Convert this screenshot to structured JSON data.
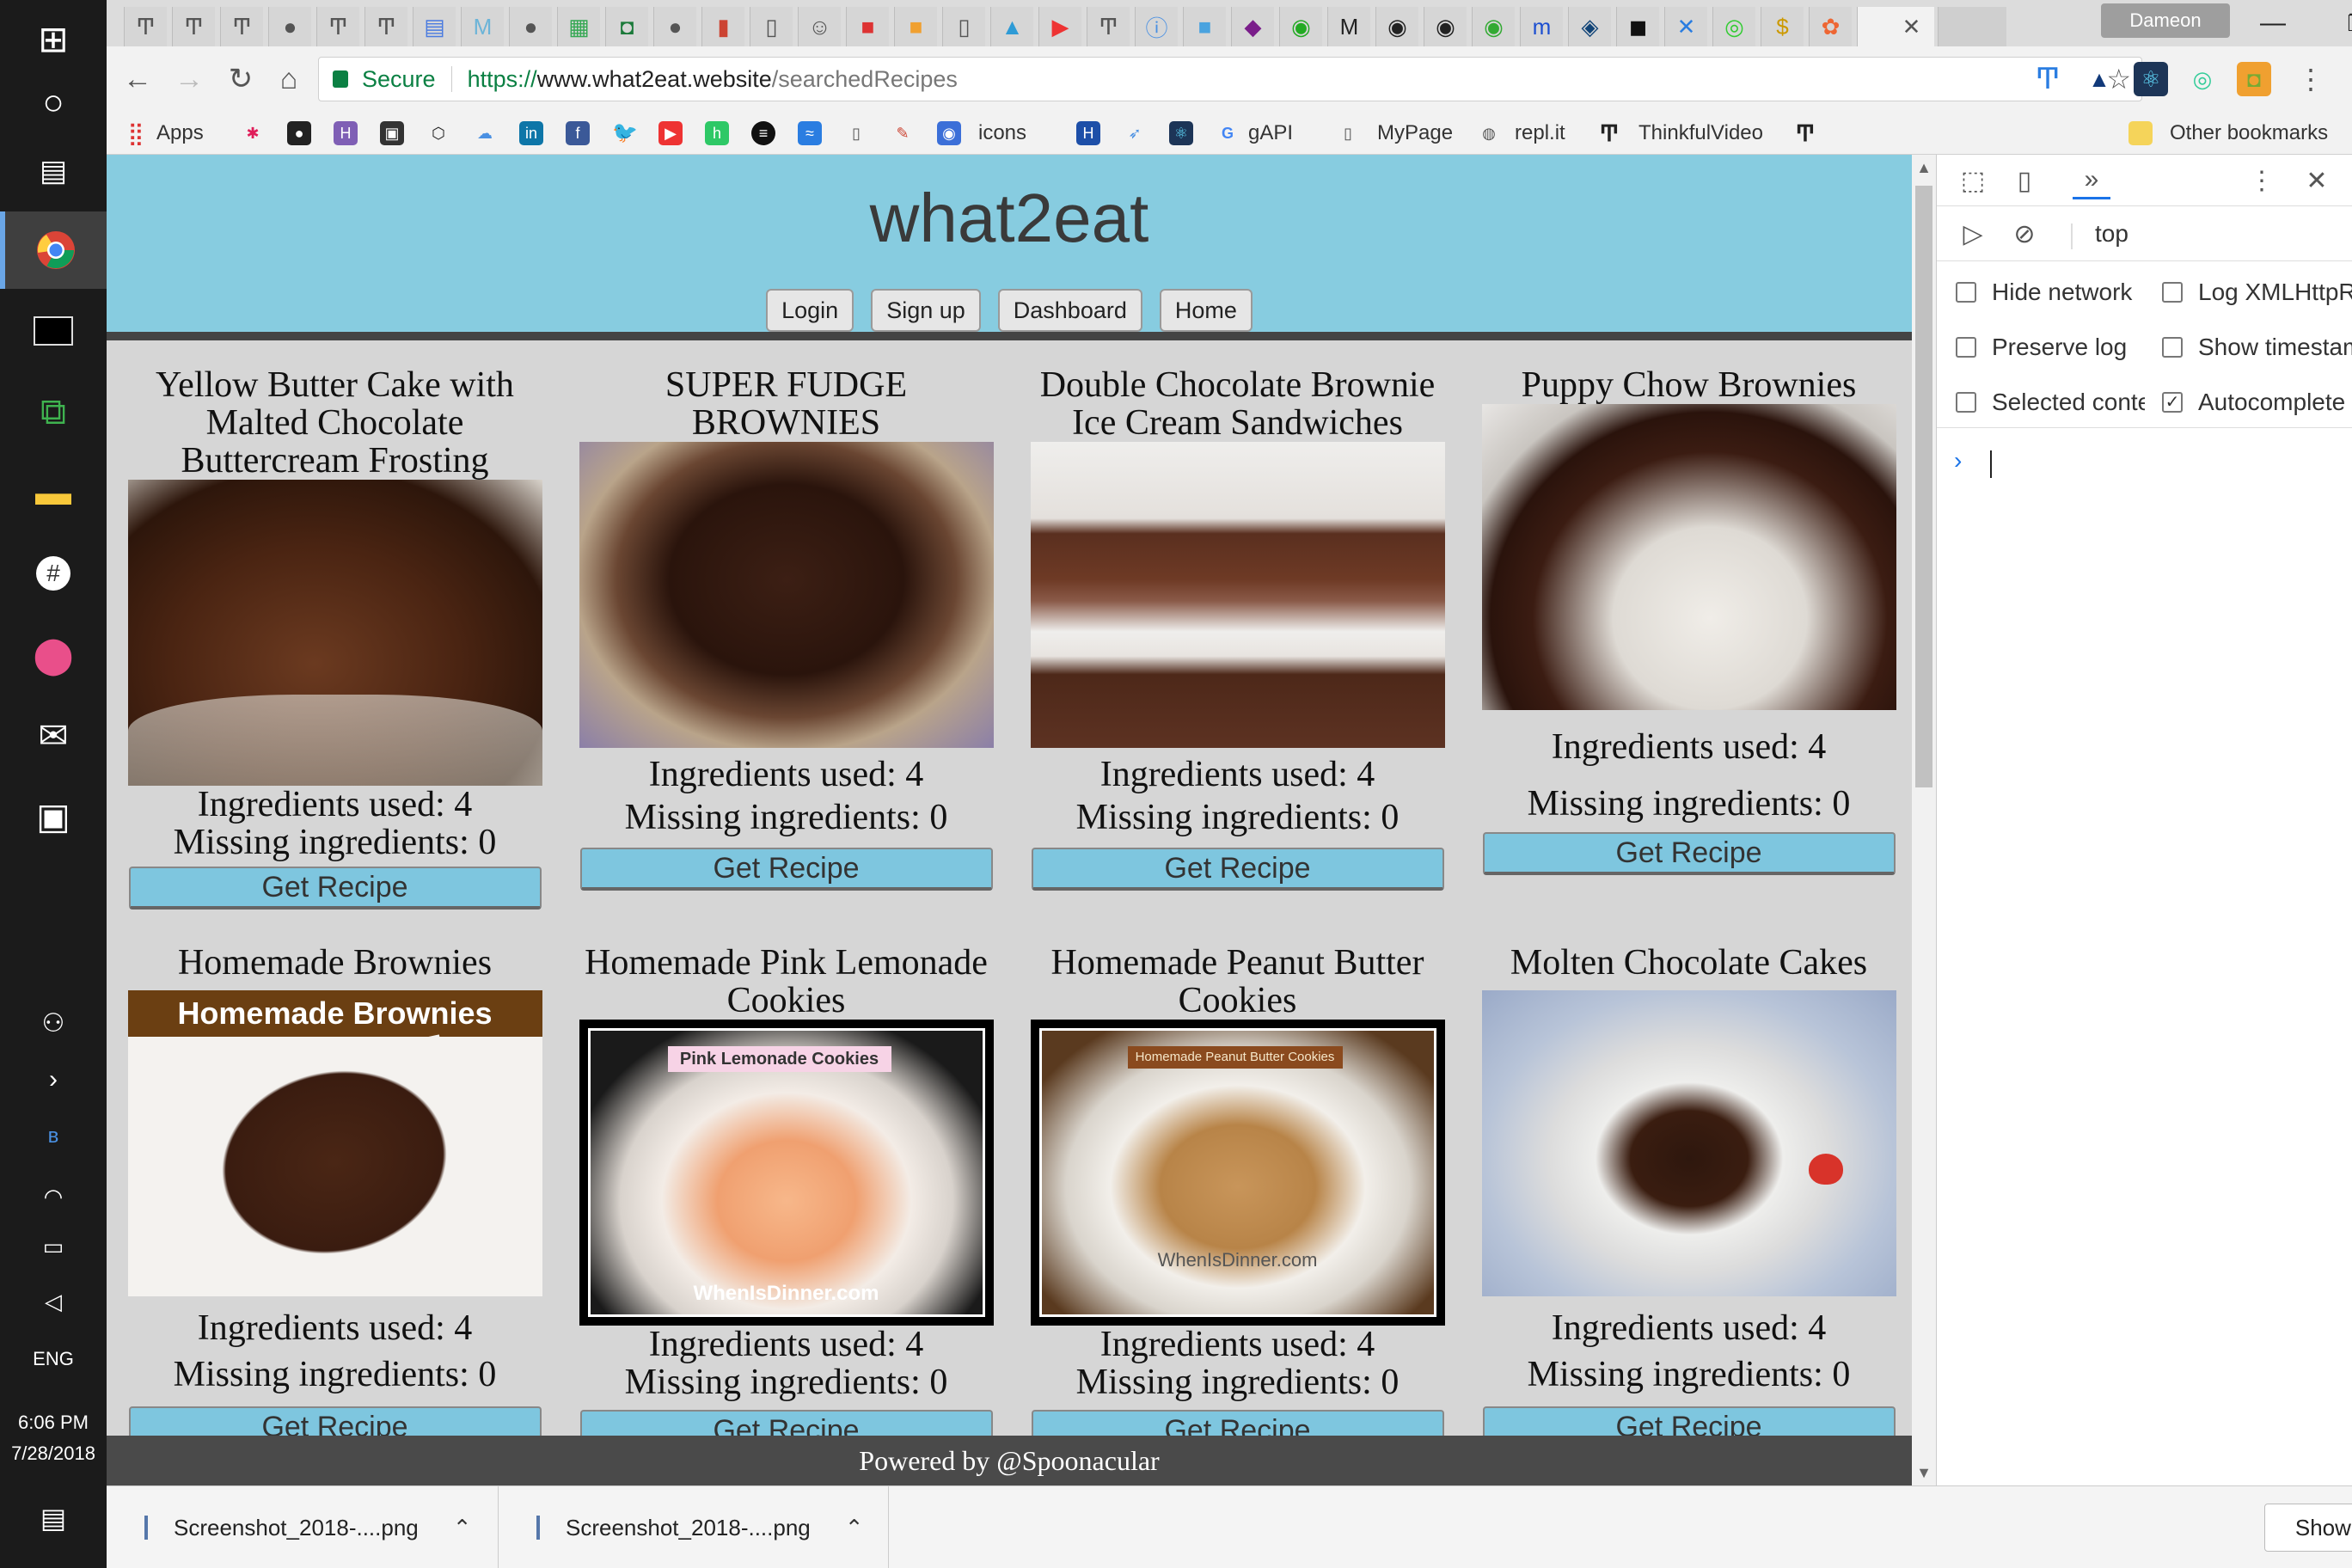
{
  "taskbar": {
    "time": "6:06 PM",
    "date": "7/28/2018",
    "language": "ENG"
  },
  "window": {
    "profile_name": "Dameon"
  },
  "toolbar": {
    "secure_label": "Secure",
    "url_scheme": "https://",
    "url_host": "www.what2eat.website",
    "url_path": "/searchedRecipes"
  },
  "bookmarks": {
    "apps": "Apps",
    "icons": "icons",
    "gapi": "gAPI",
    "mypage": "MyPage",
    "replit": "repl.it",
    "thinkful": "ThinkfulVideo",
    "other": "Other bookmarks"
  },
  "site": {
    "title": "what2eat",
    "nav": {
      "login": "Login",
      "signup": "Sign up",
      "dashboard": "Dashboard",
      "home": "Home"
    },
    "recipes": [
      {
        "title": "Yellow Butter Cake with Malted Chocolate Buttercream Frosting",
        "used": "Ingredients used: 4",
        "missing": "Missing ingredients: 0",
        "button": "Get Recipe"
      },
      {
        "title": "SUPER FUDGE BROWNIES",
        "used": "Ingredients used: 4",
        "missing": "Missing ingredients: 0",
        "button": "Get Recipe"
      },
      {
        "title": "Double Chocolate Brownie Ice Cream Sandwiches",
        "used": "Ingredients used: 4",
        "missing": "Missing ingredients: 0",
        "button": "Get Recipe"
      },
      {
        "title": "Puppy Chow Brownies",
        "used": "Ingredients used: 4",
        "missing": "Missing ingredients: 0",
        "button": "Get Recipe"
      },
      {
        "title": "Homemade Brownies",
        "used": "Ingredients used: 4",
        "missing": "Missing ingredients: 0",
        "button": "Get Recipe",
        "image_text": "Homemade Brownies"
      },
      {
        "title": "Homemade Pink Lemonade Cookies",
        "used": "Ingredients used: 4",
        "missing": "Missing ingredients: 0",
        "button": "Get Recipe",
        "image_text": "Pink Lemonade Cookies",
        "image_credit": "WhenIsDinner.com"
      },
      {
        "title": "Homemade Peanut Butter Cookies",
        "used": "Ingredients used: 4",
        "missing": "Missing ingredients: 0",
        "button": "Get Recipe",
        "image_text": "Homemade Peanut Butter Cookies",
        "image_credit": "WhenIsDinner.com"
      },
      {
        "title": "Molten Chocolate Cakes",
        "used": "Ingredients used: 4",
        "missing": "Missing ingredients: 0",
        "button": "Get Recipe"
      }
    ],
    "footer": "Powered by @Spoonacular"
  },
  "devtools": {
    "context": "top",
    "options": {
      "hide_network": "Hide network",
      "log_xhr": "Log XMLHttpRequests",
      "preserve_log": "Preserve log",
      "show_timestamps": "Show timestamps",
      "selected_context": "Selected context only",
      "autocomplete": "Autocomplete from history"
    }
  },
  "downloads": {
    "items": [
      "Screenshot_2018-....png",
      "Screenshot_2018-....png"
    ],
    "show_all": "Show all"
  }
}
